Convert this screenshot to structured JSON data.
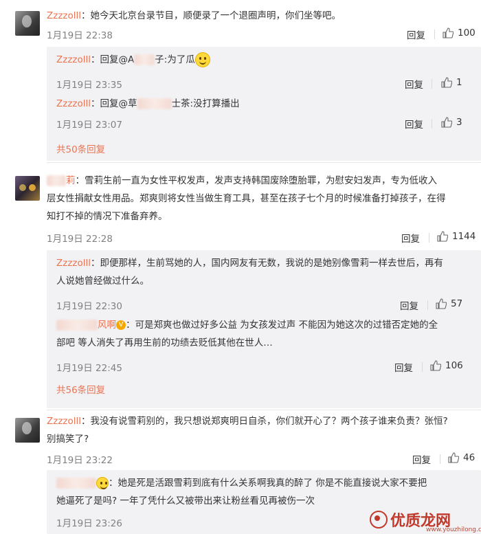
{
  "ui": {
    "reply_label": "回复"
  },
  "comments": [
    {
      "user": "Zzzzolll",
      "text": "：她今天北京台录节目，顺便录了一个退圈声明，你们坐等吧。",
      "time": "1月19日 22:38",
      "likes": "100",
      "replies": [
        {
          "user": "Zzzzolll",
          "pre": "：回复@A",
          "post": "子:为了瓜",
          "time": "1月19日 23:35",
          "likes": "1"
        },
        {
          "user": "Zzzzolll",
          "pre": "：回复@草",
          "post": "士茶:没打算播出",
          "time": "1月19日 23:07",
          "likes": "3"
        }
      ],
      "more": "共50条回复"
    },
    {
      "user_tail": "莉",
      "text1": "：雪莉生前一直为女性平权发声，发声支持韩国废除堕胎罪，为慰安妇发声，专为低收入",
      "text2": "层女性捐献女性用品。郑爽则将女性当做生育工具，甚至在孩子七个月的时候准备打掉孩子，在得",
      "text3": "知打不掉的情况下准备弃养。",
      "time": "1月19日 22:28",
      "likes": "1144",
      "replies": [
        {
          "user": "Zzzzolll",
          "text1": "：即便那样，生前骂她的人，国内网友有无数，我说的是她别像雪莉一样去世后，再有",
          "text2": "人说她曾经做过什么。",
          "time": "1月19日 22:30",
          "likes": "57"
        },
        {
          "user_tail": "风啊",
          "text1": "：可是郑爽也做过好多公益 为女孩发过声 不能因为她这次的过错否定她的全",
          "text2": "部吧 等人消失了再用生前的功绩去贬低其他在世人…",
          "time": "1月19日 22:45",
          "likes": "106"
        }
      ],
      "more": "共56条回复"
    },
    {
      "user": "Zzzzolll",
      "text1": "：我没有说雪莉别的，我只想说郑爽明日自杀，你们就开心了？两个孩子谁来负责？张恒?",
      "text2": "别搞笑了?",
      "time": "1月19日 23:22",
      "likes": "46",
      "replies": [
        {
          "text1": "：她是死是活跟雪莉到底有什么关系啊我真的醉了 你是不能直接说大家不要把",
          "text2": "她逼死了是吗? 一年了凭什么又被带出来让粉丝看见再被伤一次",
          "time": "1月19日 23:26"
        }
      ]
    }
  ],
  "watermark": {
    "text": "优质龙网",
    "url": "www.youzhilong.com"
  }
}
